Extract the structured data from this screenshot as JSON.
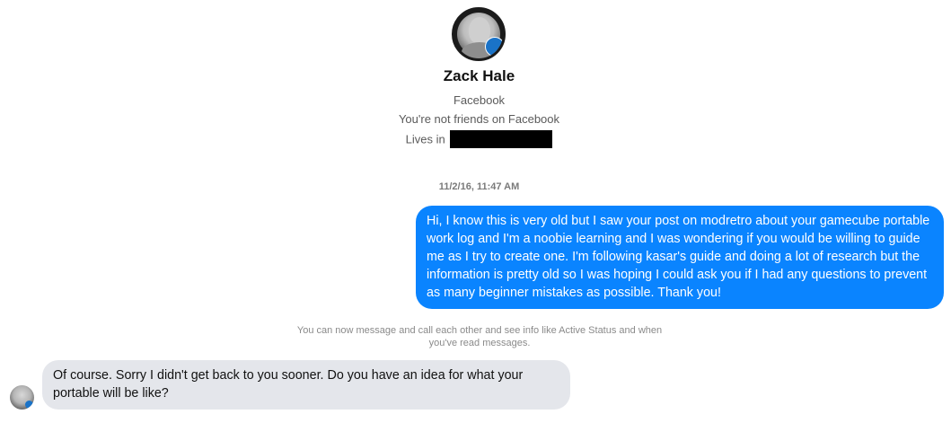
{
  "profile": {
    "name": "Zack Hale",
    "source": "Facebook",
    "friend_status": "You're not friends on Facebook",
    "lives_in_label": "Lives in",
    "avatar_icon": "profile-photo-icon"
  },
  "conversation": {
    "timestamp": "11/2/16, 11:47 AM",
    "sent_message": "Hi, I know this is very old but I saw your post on modretro about your gamecube portable work log and I'm a noobie learning and I was wondering if you would be willing to guide me as I try to create one.  I'm following kasar's guide and doing a lot of research but the information is pretty old so I was hoping I could ask you if I had any questions to prevent as many beginner mistakes as possible.  Thank you!",
    "notice": "You can now message and call each other and see info like Active Status and when you've read messages.",
    "received_message": "Of course. Sorry I didn't get back to you sooner. Do you have an idea for what your portable will be like?"
  },
  "colors": {
    "sent_bubble": "#0a84ff",
    "received_bubble": "#e4e6eb",
    "redaction": "#000000"
  }
}
